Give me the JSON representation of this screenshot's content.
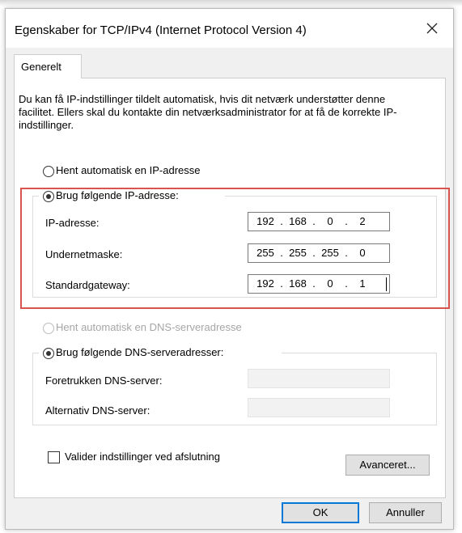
{
  "window": {
    "title": "Egenskaber for TCP/IPv4 (Internet Protocol Version 4)"
  },
  "tabs": [
    {
      "label": "Generelt"
    }
  ],
  "description": "Du kan få IP-indstillinger tildelt automatisk, hvis dit netværk understøtter denne facilitet. Ellers skal du kontakte din netværksadministrator for at få de korrekte IP-indstillinger.",
  "ip": {
    "auto_label": "Hent automatisk en IP-adresse",
    "manual_label": "Brug følgende IP-adresse:",
    "selected": "manual",
    "fields": [
      {
        "label": "IP-adresse:",
        "value": [
          "192",
          "168",
          "0",
          "2"
        ]
      },
      {
        "label": "Undernetmaske:",
        "value": [
          "255",
          "255",
          "255",
          "0"
        ]
      },
      {
        "label": "Standardgateway:",
        "value": [
          "192",
          "168",
          "0",
          "1"
        ]
      }
    ]
  },
  "dns": {
    "auto_label": "Hent automatisk en DNS-serveradresse",
    "manual_label": "Brug følgende DNS-serveradresser:",
    "selected": "manual",
    "preferred_label": "Foretrukken DNS-server:",
    "alternate_label": "Alternativ DNS-server:",
    "preferred_value": "",
    "alternate_value": ""
  },
  "validate": {
    "label": "Valider indstillinger ved afslutning",
    "checked": false
  },
  "buttons": {
    "advanced": "Avanceret...",
    "ok": "OK",
    "cancel": "Annuller"
  },
  "colors": {
    "highlight": "#d9534f",
    "default_button_border": "#0078d7"
  }
}
